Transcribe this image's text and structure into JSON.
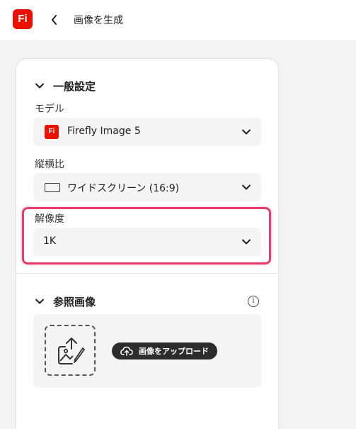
{
  "app": {
    "logo_text": "Fi",
    "brand_color": "#eb1000"
  },
  "header": {
    "title": "画像を生成",
    "back_icon": "chevron-left-icon"
  },
  "general_settings": {
    "title": "一般設定",
    "model": {
      "label": "モデル",
      "value": "Firefly Image 5",
      "icon": "firefly-icon",
      "icon_text": "Fi"
    },
    "aspect_ratio": {
      "label": "縦横比",
      "value": "ワイドスクリーン (16:9)",
      "icon": "widescreen-icon"
    },
    "resolution": {
      "label": "解像度",
      "value": "1K"
    }
  },
  "reference_image": {
    "title": "参照画像",
    "info_icon": "info-icon",
    "info_glyph": "i",
    "upload_label": "画像をアップロード",
    "upload_icon": "cloud-upload-icon",
    "dropzone_icon": "image-upload-icon"
  },
  "colors": {
    "highlight": "#ea3b6f",
    "panel_bg": "#ffffff",
    "canvas_bg": "#f3f3f3"
  }
}
